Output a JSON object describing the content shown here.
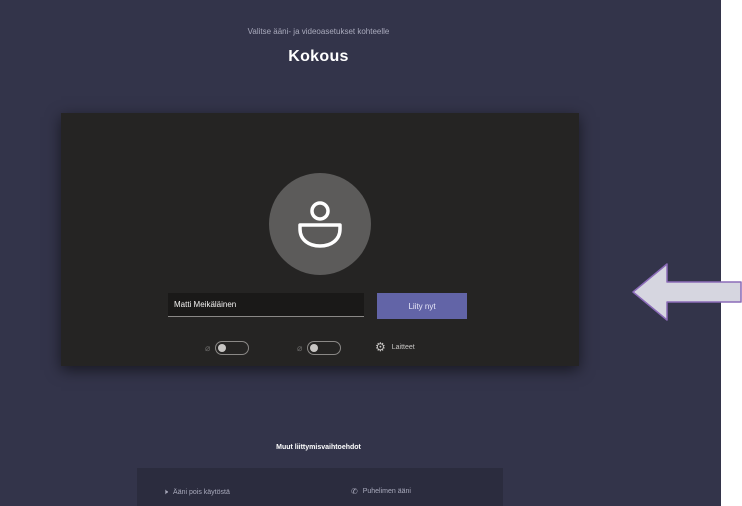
{
  "header": {
    "subtitle": "Valitse ääni- ja videoasetukset kohteelle",
    "meeting_title": "Kokous"
  },
  "preview": {
    "avatar_icon": "person-icon",
    "name_input_value": "Matti Meikäläinen",
    "join_button_label": "Liity nyt",
    "camera_icon": "camera-off-icon",
    "mic_icon": "mic-off-icon",
    "camera_on": false,
    "mic_on": false,
    "settings_label": "Laitteet"
  },
  "other_options": {
    "title": "Muut liittymisvaihtoehdot",
    "audio_off_label": "Ääni pois käytöstä",
    "phone_audio_label": "Puhelimen ääni"
  },
  "colors": {
    "background": "#33344a",
    "preview_background": "#252423",
    "join_button": "#6264a7",
    "arrow": "#d6d6e0",
    "arrow_outline": "#8b6bb8"
  }
}
